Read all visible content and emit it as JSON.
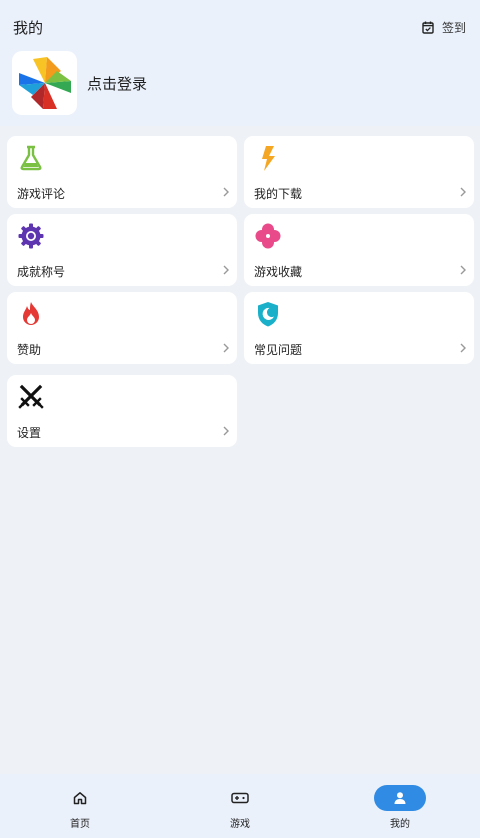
{
  "header": {
    "title": "我的",
    "checkin_label": "签到"
  },
  "profile": {
    "login_label": "点击登录"
  },
  "menu": [
    {
      "label": "游戏评论",
      "icon": "flask-icon",
      "color": "#7ac143"
    },
    {
      "label": "我的下载",
      "icon": "bolt-icon",
      "color": "#f5a623"
    },
    {
      "label": "成就称号",
      "icon": "gear-icon",
      "color": "#5e35b1"
    },
    {
      "label": "游戏收藏",
      "icon": "clover-icon",
      "color": "#e94b8a"
    },
    {
      "label": "赞助",
      "icon": "flame-icon",
      "color": "#e53935"
    },
    {
      "label": "常见问题",
      "icon": "moon-shield-icon",
      "color": "#1ab0c9"
    },
    {
      "label": "设置",
      "icon": "crossed-swords-icon",
      "color": "#111111"
    }
  ],
  "bottom_nav": [
    {
      "label": "首页",
      "icon": "home-icon",
      "active": false
    },
    {
      "label": "游戏",
      "icon": "gamepad-icon",
      "active": false
    },
    {
      "label": "我的",
      "icon": "person-icon",
      "active": true
    }
  ],
  "colors": {
    "accent": "#2f8be3",
    "background": "#eef1f6",
    "header_bg": "#eaf1fb"
  }
}
